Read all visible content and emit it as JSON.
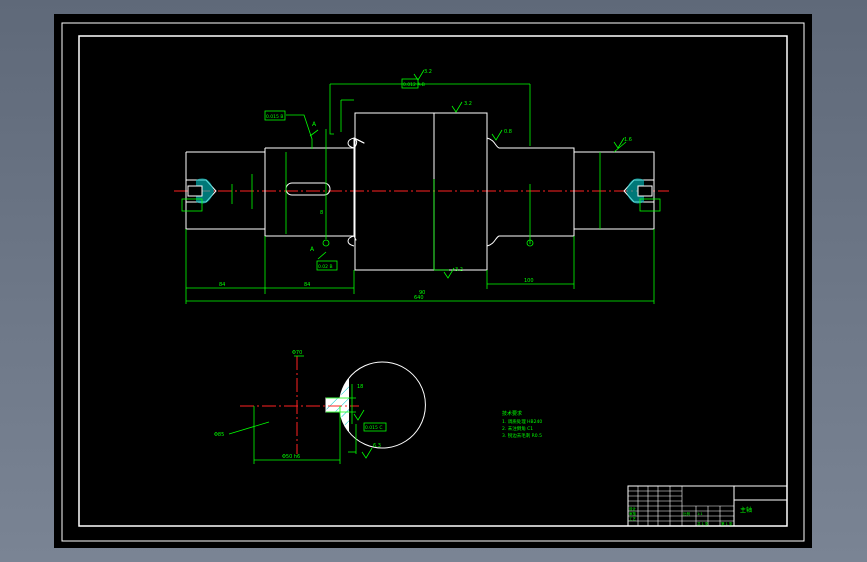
{
  "drawing": {
    "roughness_values": [
      "3.2",
      "3.2",
      "0.8",
      "1.6",
      "3.2",
      "3.2",
      "6.3"
    ],
    "tolerance_frames": [
      "0.012 A-B",
      "0.015 B",
      "0.02 B",
      "0.02 A",
      "0.015 C"
    ],
    "datum_labels": [
      "A",
      "B",
      "C"
    ],
    "dimensions": {
      "total_length": "640",
      "left_end": "84",
      "second_step": "84",
      "middle": "90",
      "right_section": "100",
      "key_depth": "8",
      "section_width": "Φ50 h6"
    },
    "section_labels": [
      "Φ70",
      "18",
      "Φ85"
    ],
    "notes": {
      "title": "技术要求",
      "lines": [
        "1. 调质处理 HB240",
        "2. 未注倒角 C1",
        "3. 锐边去毛刺 R0.5"
      ]
    },
    "title_block": {
      "drawing_name": "主轴",
      "cells": [
        "设计",
        "审核",
        "工艺",
        "比例",
        "1:1",
        "共 1 张",
        "第 1 张"
      ]
    }
  },
  "colors": {
    "sheet": "#000000",
    "outline": "#ffffff",
    "dimension": "#00ff00",
    "centerline": "#ff2222",
    "hatch": "#00c8c8",
    "section_fill": "#ffffff"
  }
}
